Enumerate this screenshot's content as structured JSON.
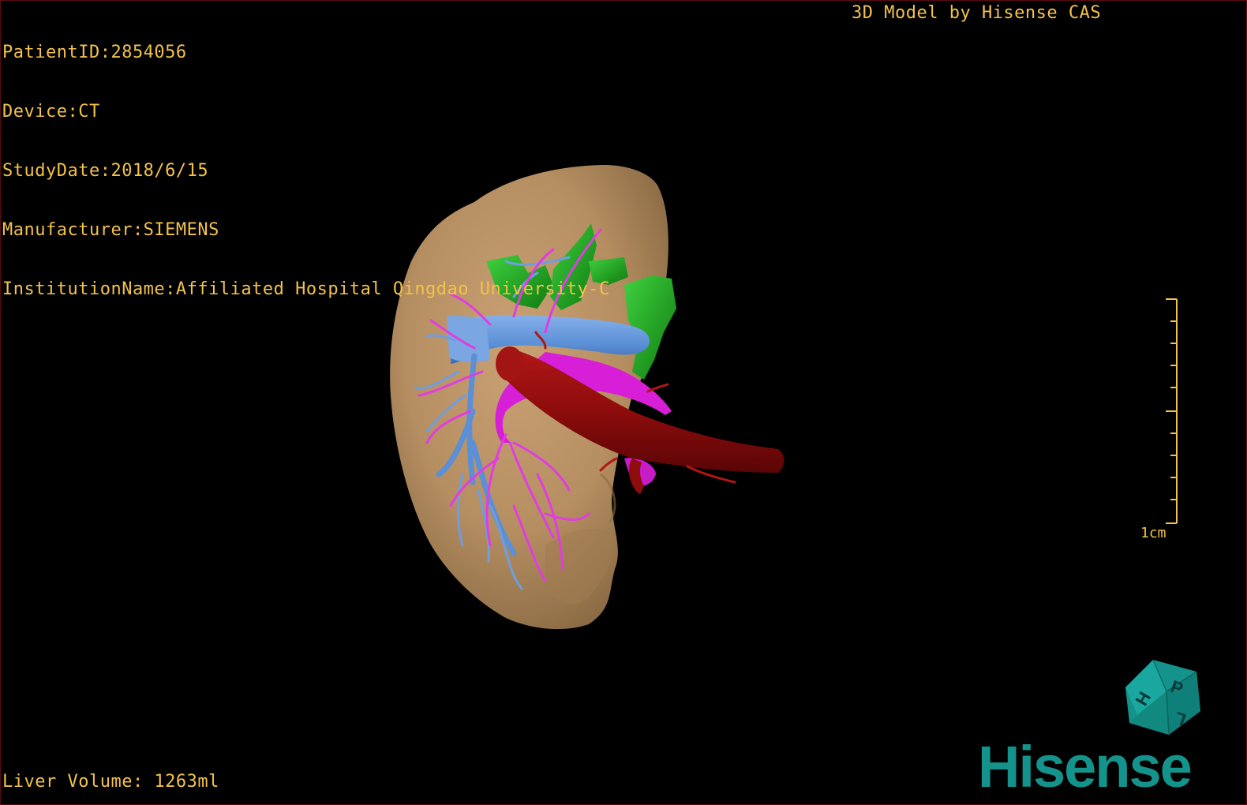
{
  "patient_info": {
    "patient_id": "PatientID:2854056",
    "device": "Device:CT",
    "study_date": "StudyDate:2018/6/15",
    "manufacturer": "Manufacturer:SIEMENS",
    "institution": "InstitutionName:Affiliated Hospital Qingdao University-C"
  },
  "model_credit": "3D Model by Hisense CAS",
  "liver_volume": "Liver Volume: 1263ml",
  "scale": {
    "label": "1cm"
  },
  "orientation_cube": {
    "face_labels": [
      "P",
      "H",
      "L"
    ]
  },
  "logo": {
    "text": "Hisense"
  },
  "colors": {
    "overlay_text": "#f2c24a",
    "liver": "#b58e61",
    "portal_vein": "#5b8fd6",
    "hepatic_artery": "#d61fd6",
    "hepatic_vein": "#17a317",
    "ivc": "#8e0c0c",
    "brand": "#14938c"
  }
}
